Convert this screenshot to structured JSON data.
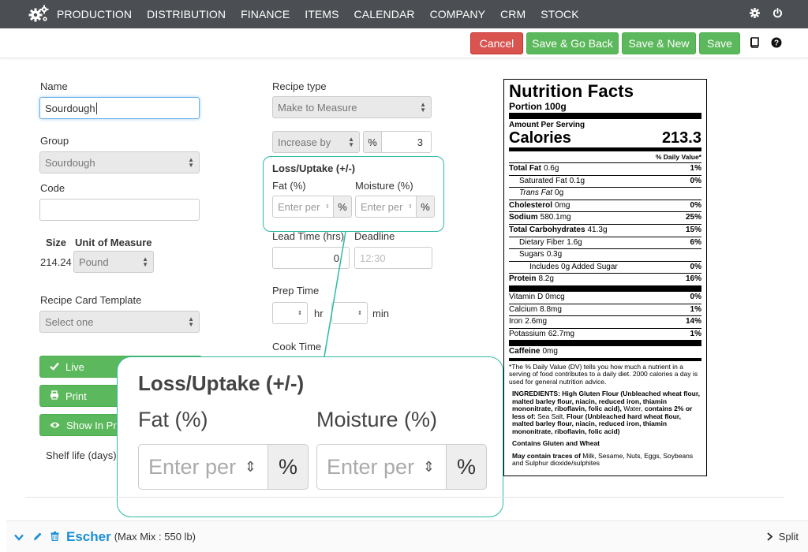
{
  "nav": {
    "items": [
      "PRODUCTION",
      "DISTRIBUTION",
      "FINANCE",
      "ITEMS",
      "CALENDAR",
      "COMPANY",
      "CRM",
      "STOCK"
    ],
    "logo_icon": "gears-icon",
    "right_icons": [
      "gear-icon",
      "power-icon"
    ]
  },
  "actions": {
    "cancel": "Cancel",
    "save_go_back": "Save & Go Back",
    "save_new": "Save & New",
    "save": "Save",
    "book_icon": "book-icon",
    "help_icon": "help-icon"
  },
  "form": {
    "name_label": "Name",
    "name_value": "Sourdough",
    "group_label": "Group",
    "group_value": "Sourdough",
    "code_label": "Code",
    "code_value": "",
    "size_label": "Size",
    "uom_label": "Unit of Measure",
    "size_value": "214.24",
    "uom_value": "Pound",
    "recipe_card_label": "Recipe Card Template",
    "recipe_card_value": "Select one",
    "live_button": "Live",
    "print_button": "Print",
    "show_in_button": "Show In Pr",
    "shelf_life_label": "Shelf life (days)",
    "recipe_type_label": "Recipe type",
    "recipe_type_value": "Make to Measure",
    "increase_by_value": "Increase by",
    "percent_addon": "%",
    "increase_amount": "3",
    "loss_uptake_title": "Loss/Uptake (+/-)",
    "fat_label": "Fat (%)",
    "moisture_label": "Moisture (%)",
    "fat_placeholder": "Enter per",
    "moisture_placeholder": "Enter per",
    "lead_time_label": "Lead Time (hrs)",
    "lead_time_value": "0",
    "deadline_label": "Deadline",
    "deadline_hour": "12",
    "deadline_minute": "30",
    "prep_time_label": "Prep Time",
    "hr_label": "hr",
    "min_label": "min",
    "cook_time_label": "Cook Time"
  },
  "zoom": {
    "title": "Loss/Uptake (+/-)",
    "fat_label": "Fat (%)",
    "moisture_label": "Moisture (%)",
    "fat_placeholder": "Enter per",
    "moisture_placeholder": "Enter per",
    "addon": "%"
  },
  "nutrition": {
    "title": "Nutrition Facts",
    "portion": "Portion 100g",
    "amount_per_serving": "Amount Per Serving",
    "calories_label": "Calories",
    "calories_value": "213.3",
    "daily_value_header": "% Daily Value*",
    "rows": [
      {
        "label": "Total Fat",
        "amount": "0.6g",
        "dv": "1%",
        "bold": true,
        "indent": 0,
        "style": "thin"
      },
      {
        "label": "Saturated Fat",
        "amount": "0.1g",
        "dv": "0%",
        "bold": false,
        "indent": 1,
        "style": "thin"
      },
      {
        "label": "Trans Fat",
        "amount": "0g",
        "dv": "",
        "bold": false,
        "indent": 1,
        "style": "thin",
        "italic": true
      },
      {
        "label": "Cholesterol",
        "amount": "0mg",
        "dv": "0%",
        "bold": true,
        "indent": 0,
        "style": "thin"
      },
      {
        "label": "Sodium",
        "amount": "580.1mg",
        "dv": "25%",
        "bold": true,
        "indent": 0,
        "style": "thin"
      },
      {
        "label": "Total Carbohydrates",
        "amount": "41.3g",
        "dv": "15%",
        "bold": true,
        "indent": 0,
        "style": "thin"
      },
      {
        "label": "Dietary Fiber",
        "amount": "1.6g",
        "dv": "6%",
        "bold": false,
        "indent": 1,
        "style": "thin"
      },
      {
        "label": "Sugars",
        "amount": "0.3g",
        "dv": "",
        "bold": false,
        "indent": 1,
        "style": "thin"
      },
      {
        "label": "Includes 0g Added Sugar",
        "amount": "",
        "dv": "0%",
        "bold": false,
        "indent": 2,
        "style": "thin"
      },
      {
        "label": "Protein",
        "amount": "8.2g",
        "dv": "16%",
        "bold": true,
        "indent": 0,
        "style": "thick"
      },
      {
        "label": "Vitamin D",
        "amount": "0mcg",
        "dv": "0%",
        "bold": false,
        "indent": 0,
        "style": "thin"
      },
      {
        "label": "Calcium",
        "amount": "8.8mg",
        "dv": "1%",
        "bold": false,
        "indent": 0,
        "style": "thin"
      },
      {
        "label": "Iron",
        "amount": "2.6mg",
        "dv": "14%",
        "bold": false,
        "indent": 0,
        "style": "thin"
      },
      {
        "label": "Potassium",
        "amount": "62.7mg",
        "dv": "1%",
        "bold": false,
        "indent": 0,
        "style": "thick"
      },
      {
        "label": "Caffeine",
        "amount": "0mg",
        "dv": "",
        "bold": true,
        "indent": 0,
        "style": "med"
      }
    ],
    "footnote": "*The % Daily Value (DV) tells you how much a nutrient in a serving of food contributes to a daily diet. 2000 calories a day is used for general nutrition advice.",
    "ingredients_label": "INGREDIENTS:",
    "ingredients_text_1": "High Gluten Flour (Unbleached wheat flour, malted barley flour, niacin, reduced iron, thiamin mononitrate, riboflavin, folic acid),",
    "ingredients_water": "Water,",
    "ingredients_text_2": "contains 2% or less of:",
    "ingredients_salt": "Sea Salt,",
    "ingredients_text_3": "Flour (Unbleached hard wheat flour, malted barley flour, niacin, reduced iron, thiamin mononitrate, riboflavin, folic acid)",
    "contains": "Contains Gluten and Wheat",
    "may_contain_label": "May contain traces of",
    "may_contain_text": "Milk, Sesame, Nuts, Eggs, Soybeans and Sulphur dioxide/sulphites"
  },
  "bottom": {
    "name": "Escher",
    "detail": "(Max Mix : 550 lb)",
    "split": "Split"
  },
  "colors": {
    "nav_bg": "#4b4e52",
    "red": "#d9534f",
    "green": "#5cb85c",
    "highlight": "#2ebaa4",
    "link_blue": "#1a8fd8"
  }
}
